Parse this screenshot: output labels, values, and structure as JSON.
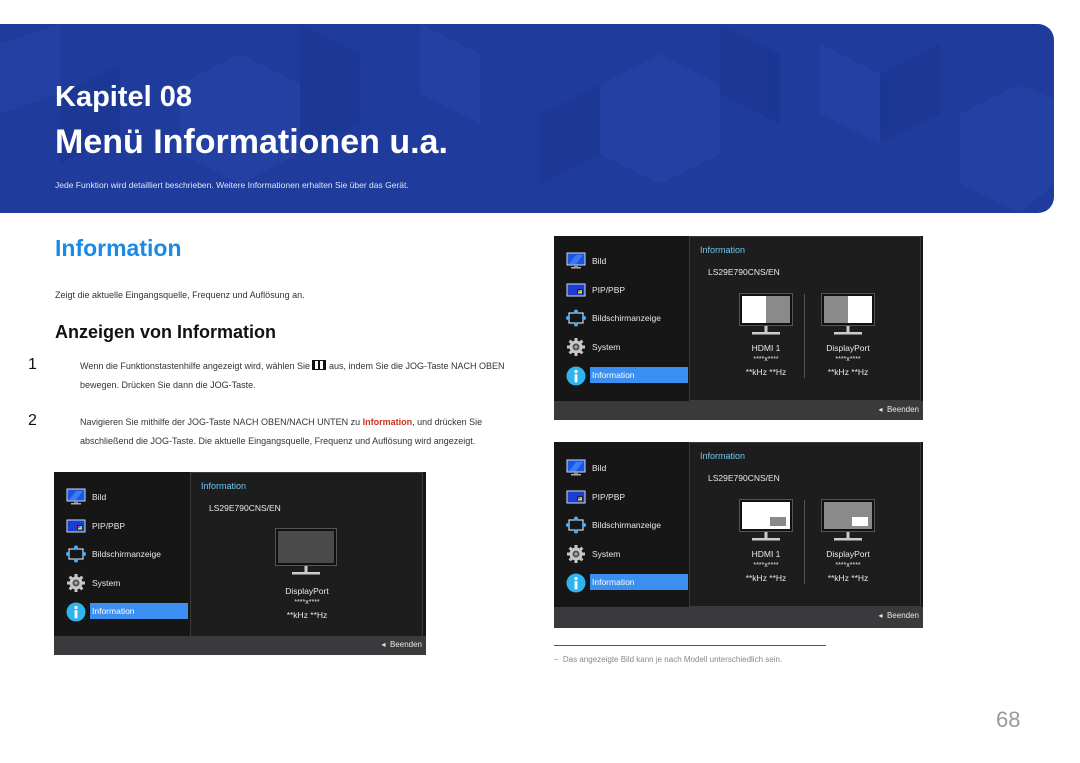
{
  "banner": {
    "chapter": "Kapitel 08",
    "title": "Menü Informationen u.a.",
    "description": "Jede Funktion wird detailliert beschrieben. Weitere Informationen erhalten Sie über das Gerät.",
    "color": "#1f3c9c"
  },
  "section": {
    "title": "Information",
    "description": "Zeigt die aktuelle Eingangsquelle, Frequenz und Auflösung an.",
    "subtitle": "Anzeigen von Information",
    "steps": [
      {
        "num": "1",
        "text_before": "Wenn die Funktionstastenhilfe angezeigt wird, wählen Sie ",
        "icon": "function-key-icon",
        "text_after": " aus, indem Sie die JOG-Taste NACH OBEN bewegen. Drücken Sie dann die JOG-Taste."
      },
      {
        "num": "2",
        "text_before": "Navigieren Sie mithilfe der JOG-Taste NACH OBEN/NACH UNTEN zu ",
        "highlight": "Information",
        "text_after": ", und drücken Sie abschließend die JOG-Taste. Die aktuelle Eingangsquelle, Frequenz und Auflösung wird angezeigt."
      }
    ]
  },
  "osd_menu": {
    "items": [
      {
        "label": "Bild",
        "icon": "picture-icon"
      },
      {
        "label": "PIP/PBP",
        "icon": "pip-pbp-icon"
      },
      {
        "label": "Bildschirmanzeige",
        "icon": "onscreen-display-icon"
      },
      {
        "label": "System",
        "icon": "gear-icon"
      },
      {
        "label": "Information",
        "icon": "info-icon",
        "active": true
      }
    ],
    "exit_label": "Beenden",
    "info_title": "Information",
    "model": "LS29E790CNS/EN"
  },
  "screens": [
    {
      "mode": "single",
      "sources": [
        {
          "name": "DisplayPort",
          "resolution": "****x****",
          "frequency": "**kHz **Hz"
        }
      ]
    },
    {
      "mode": "pbp",
      "sources": [
        {
          "name": "HDMI 1",
          "resolution": "****x****",
          "frequency": "**kHz **Hz"
        },
        {
          "name": "DisplayPort",
          "resolution": "****x****",
          "frequency": "**kHz **Hz"
        }
      ]
    },
    {
      "mode": "pip",
      "sources": [
        {
          "name": "HDMI 1",
          "resolution": "****x****",
          "frequency": "**kHz **Hz"
        },
        {
          "name": "DisplayPort",
          "resolution": "****x****",
          "frequency": "**kHz **Hz"
        }
      ]
    }
  ],
  "footnote": "Das angezeigte Bild kann je nach Modell unterschiedlich sein.",
  "page_number": "68",
  "colors": {
    "accent_blue": "#1a8ae6",
    "highlight_red": "#c8321e",
    "osd_active": "#3b8ff0",
    "osd_title": "#6ec7f0"
  }
}
